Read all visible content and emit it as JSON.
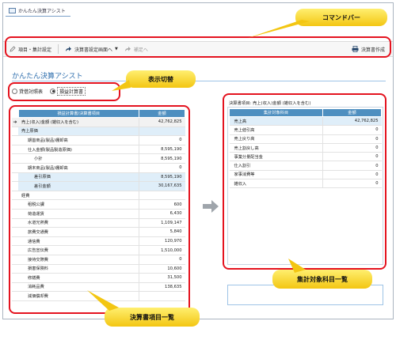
{
  "window": {
    "tab_title": "かんたん決算アシスト"
  },
  "toolbar": {
    "item_setting": "項目・集計設定",
    "doc_setting": "決算書設定画面へ",
    "supplement": "補足へ",
    "create": "決算書作成"
  },
  "app_title": "かんたん決算アシスト",
  "radio": {
    "option1": "貸借対照表",
    "option2": "損益計算書",
    "selected": "損益計算書"
  },
  "left_table": {
    "headers": [
      "損益計算書/決算書項目",
      "金額"
    ],
    "rows": [
      {
        "arrow": "➔",
        "name": "売上(収入)金額 (雑収入を含む)",
        "value": "42,762,825",
        "indent": 0,
        "style": "sel"
      },
      {
        "arrow": "",
        "name": "売上原価",
        "value": "",
        "indent": 0,
        "style": "sub"
      },
      {
        "arrow": "",
        "name": "期首商品(製品)棚卸高",
        "value": "0",
        "indent": 1,
        "style": ""
      },
      {
        "arrow": "",
        "name": "仕入金額(製品製造原価)",
        "value": "8,595,190",
        "indent": 1,
        "style": ""
      },
      {
        "arrow": "",
        "name": "小計",
        "value": "8,595,190",
        "indent": 2,
        "style": ""
      },
      {
        "arrow": "",
        "name": "期末商品(製品)棚卸高",
        "value": "0",
        "indent": 1,
        "style": ""
      },
      {
        "arrow": "",
        "name": "差引原価",
        "value": "8,595,190",
        "indent": 2,
        "style": "sub"
      },
      {
        "arrow": "",
        "name": "差引金額",
        "value": "30,167,635",
        "indent": 2,
        "style": "sub"
      },
      {
        "arrow": "",
        "name": "経費",
        "value": "",
        "indent": 0,
        "style": ""
      },
      {
        "arrow": "",
        "name": "租税公課",
        "value": "600",
        "indent": 1,
        "style": ""
      },
      {
        "arrow": "",
        "name": "荷造運賃",
        "value": "6,430",
        "indent": 1,
        "style": ""
      },
      {
        "arrow": "",
        "name": "水道光熱費",
        "value": "1,109,147",
        "indent": 1,
        "style": ""
      },
      {
        "arrow": "",
        "name": "旅費交通費",
        "value": "5,840",
        "indent": 1,
        "style": ""
      },
      {
        "arrow": "",
        "name": "通信費",
        "value": "120,970",
        "indent": 1,
        "style": ""
      },
      {
        "arrow": "",
        "name": "広告宣伝費",
        "value": "1,510,000",
        "indent": 1,
        "style": ""
      },
      {
        "arrow": "",
        "name": "接待交際費",
        "value": "0",
        "indent": 1,
        "style": ""
      },
      {
        "arrow": "",
        "name": "損害保険料",
        "value": "10,600",
        "indent": 1,
        "style": ""
      },
      {
        "arrow": "",
        "name": "修繕費",
        "value": "31,500",
        "indent": 1,
        "style": ""
      },
      {
        "arrow": "",
        "name": "消耗品費",
        "value": "138,635",
        "indent": 1,
        "style": ""
      },
      {
        "arrow": "",
        "name": "減価償却費",
        "value": "",
        "indent": 1,
        "style": ""
      }
    ]
  },
  "right_panel": {
    "label": "決算書項目: 売上(収入)金額 (雑収入を含む)",
    "headers": [
      "集計対象科目",
      "金額"
    ],
    "rows": [
      {
        "name": "売上高",
        "value": "42,762,825",
        "style": "sub"
      },
      {
        "name": "売上値引高",
        "value": "0",
        "style": ""
      },
      {
        "name": "売上戻り高",
        "value": "0",
        "style": ""
      },
      {
        "name": "売上割戻し高",
        "value": "0",
        "style": ""
      },
      {
        "name": "事業分量配当金",
        "value": "0",
        "style": ""
      },
      {
        "name": "仕入割引",
        "value": "0",
        "style": ""
      },
      {
        "name": "家事消費等",
        "value": "0",
        "style": ""
      },
      {
        "name": "雑収入",
        "value": "0",
        "style": ""
      }
    ]
  },
  "callouts": {
    "command_bar": "コマンドバー",
    "display_switch": "表示切替",
    "doc_items": "決算書項目一覧",
    "aggregate_items": "集計対象科目一覧"
  },
  "colors": {
    "header_blue": "#4e8fc0",
    "annotation_red": "#e4131f",
    "callout_yellow": "#f7d21e"
  }
}
